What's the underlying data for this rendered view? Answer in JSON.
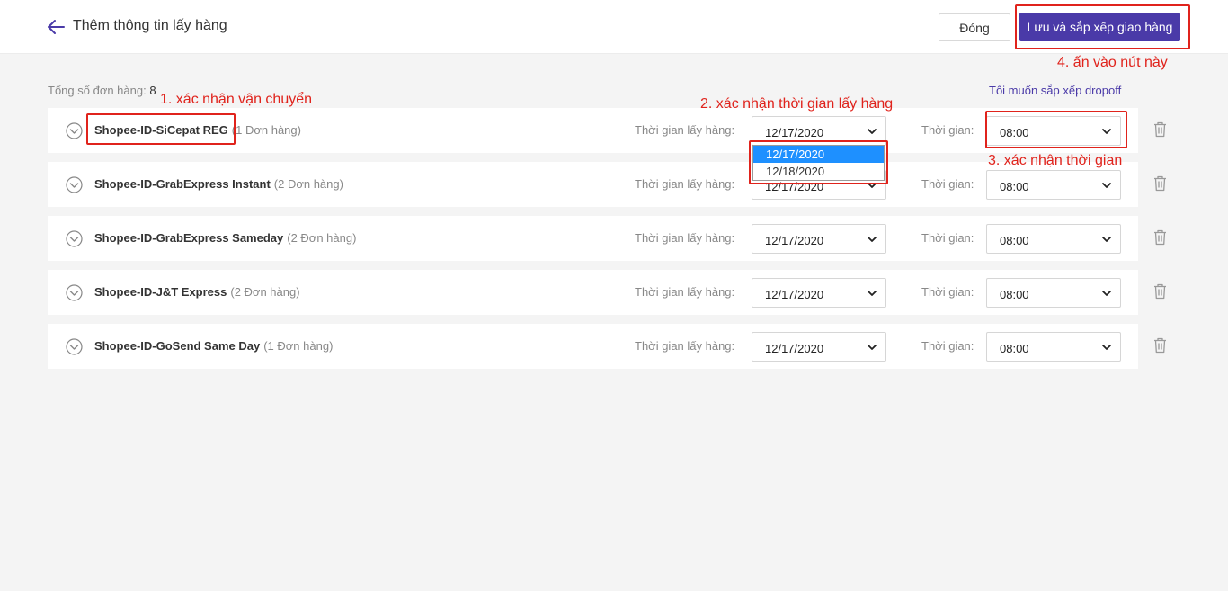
{
  "header": {
    "title": "Thêm thông tin lấy hàng",
    "close_label": "Đóng",
    "save_label": "Lưu và sắp xếp giao hàng"
  },
  "summary": {
    "total_label": "Tổng số đơn hàng:",
    "total_value": "8",
    "dropoff_link": "Tôi muốn sắp xếp dropoff"
  },
  "labels": {
    "pickup_date": "Thời gian lấy hàng:",
    "time": "Thời gian:"
  },
  "rows": [
    {
      "carrier": "Shopee-ID-SiCepat REG",
      "count": "(1 Đơn hàng)",
      "date": "12/17/2020",
      "time": "08:00"
    },
    {
      "carrier": "Shopee-ID-GrabExpress Instant",
      "count": "(2 Đơn hàng)",
      "date": "12/17/2020",
      "time": "08:00"
    },
    {
      "carrier": "Shopee-ID-GrabExpress Sameday",
      "count": "(2 Đơn hàng)",
      "date": "12/17/2020",
      "time": "08:00"
    },
    {
      "carrier": "Shopee-ID-J&T Express",
      "count": "(2 Đơn hàng)",
      "date": "12/17/2020",
      "time": "08:00"
    },
    {
      "carrier": "Shopee-ID-GoSend Same Day",
      "count": "(1 Đơn hàng)",
      "date": "12/17/2020",
      "time": "08:00"
    }
  ],
  "date_dropdown": {
    "options": [
      "12/17/2020",
      "12/18/2020"
    ],
    "selected_index": 0
  },
  "annotations": {
    "a1": "1. xác nhận vận chuyển",
    "a2": "2. xác nhận thời gian lấy hàng",
    "a3": "3. xác nhận thời gian",
    "a4": "4. ấn vào nút này"
  },
  "colors": {
    "primary": "#4a3aa8",
    "annotation": "#e0231c",
    "dropdown_highlight": "#1e90ff"
  }
}
